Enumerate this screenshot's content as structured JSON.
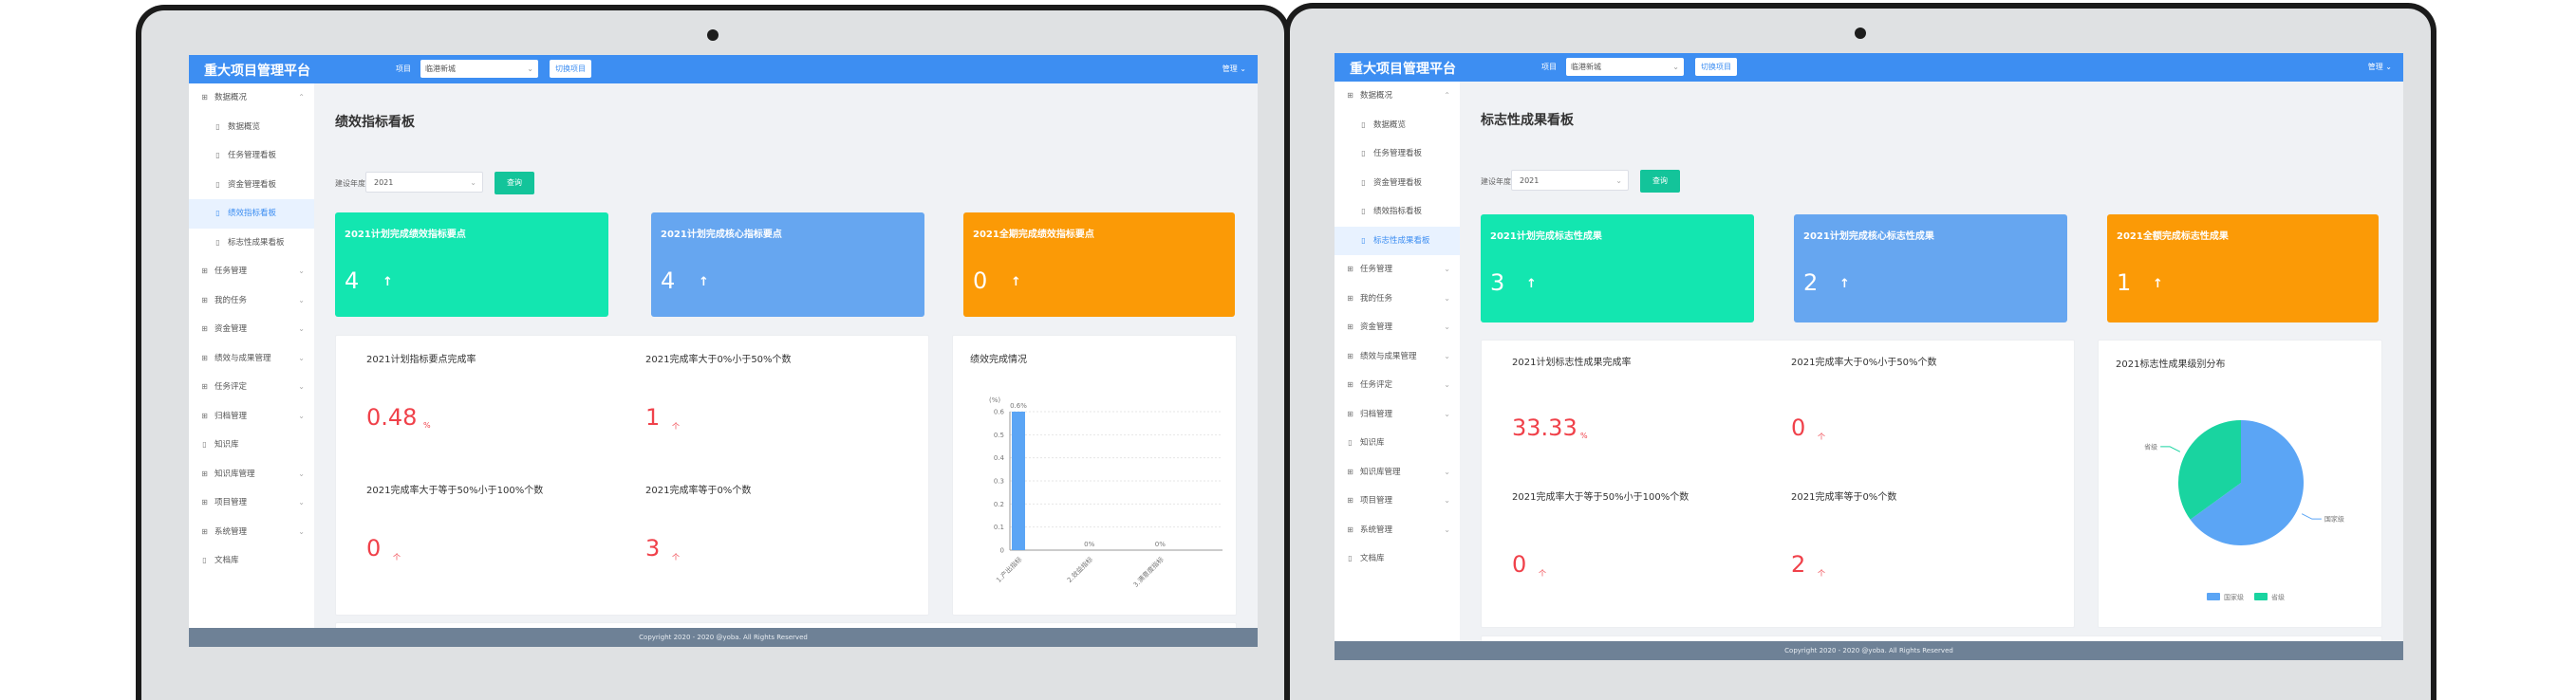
{
  "app": {
    "brand": "重大项目管理平台",
    "region_label": "项目",
    "region_value": "临港新城",
    "switch_label": "切换项目",
    "user": "管理"
  },
  "footer": "Copyright 2020 - 2020 @yoba. All Rights Reserved",
  "colors": {
    "topbar": "#3d8ef2",
    "green": "#13e6b0",
    "blue": "#66a6f0",
    "orange": "#fb9a06",
    "red": "#f0414a",
    "pie_blue": "#5ba5f5",
    "pie_green": "#19d4a0"
  },
  "sidebar": {
    "items": [
      {
        "label": "数据概况",
        "icon": "grid-icon",
        "arrow": "up"
      },
      {
        "label": "数据概览",
        "icon": "doc-icon",
        "sub": true
      },
      {
        "label": "任务管理看板",
        "icon": "doc-icon",
        "sub": true
      },
      {
        "label": "资金管理看板",
        "icon": "doc-icon",
        "sub": true
      },
      {
        "label": "绩效指标看板",
        "icon": "doc-icon",
        "sub": true
      },
      {
        "label": "标志性成果看板",
        "icon": "doc-icon",
        "sub": true
      },
      {
        "label": "任务管理",
        "icon": "grid-icon",
        "arrow": "down"
      },
      {
        "label": "我的任务",
        "icon": "grid-icon",
        "arrow": "down"
      },
      {
        "label": "资金管理",
        "icon": "grid-icon",
        "arrow": "down"
      },
      {
        "label": "绩效与成果管理",
        "icon": "grid-icon",
        "arrow": "down"
      },
      {
        "label": "任务评定",
        "icon": "grid-icon",
        "arrow": "down"
      },
      {
        "label": "归档管理",
        "icon": "grid-icon",
        "arrow": "down"
      },
      {
        "label": "知识库",
        "icon": "doc-icon"
      },
      {
        "label": "知识库管理",
        "icon": "grid-icon",
        "arrow": "down"
      },
      {
        "label": "项目管理",
        "icon": "grid-icon",
        "arrow": "down"
      },
      {
        "label": "系统管理",
        "icon": "grid-icon",
        "arrow": "down"
      },
      {
        "label": "文档库",
        "icon": "doc-icon"
      }
    ]
  },
  "left": {
    "active_index": 4,
    "title": "绩效指标看板",
    "filter_label": "建设年度",
    "filter_value": "2021",
    "query_label": "查询",
    "cards": [
      {
        "title": "2021计划完成绩效指标要点",
        "value": "4"
      },
      {
        "title": "2021计划完成核心指标要点",
        "value": "4"
      },
      {
        "title": "2021全期完成绩效指标要点",
        "value": "0"
      }
    ],
    "kpis": [
      {
        "label": "2021计划指标要点完成率",
        "value": "0.48",
        "unit": "%"
      },
      {
        "label": "2021完成率大于0%小于50%个数",
        "value": "1",
        "unit": "个"
      },
      {
        "label": "2021完成率大于等于50%小于100%个数",
        "value": "0",
        "unit": "个"
      },
      {
        "label": "2021完成率等于0%个数",
        "value": "3",
        "unit": "个"
      }
    ],
    "chart_title": "绩效完成情况"
  },
  "right": {
    "active_index": 5,
    "title": "标志性成果看板",
    "filter_label": "建设年度",
    "filter_value": "2021",
    "query_label": "查询",
    "cards": [
      {
        "title": "2021计划完成标志性成果",
        "value": "3"
      },
      {
        "title": "2021计划完成核心标志性成果",
        "value": "2"
      },
      {
        "title": "2021全额完成标志性成果",
        "value": "1"
      }
    ],
    "kpis": [
      {
        "label": "2021计划标志性成果完成率",
        "value": "33.33",
        "unit": "%"
      },
      {
        "label": "2021完成率大于0%小于50%个数",
        "value": "0",
        "unit": "个"
      },
      {
        "label": "2021完成率大于等于50%小于100%个数",
        "value": "0",
        "unit": "个"
      },
      {
        "label": "2021完成率等于0%个数",
        "value": "2",
        "unit": "个"
      }
    ],
    "chart_title": "2021标志性成果级别分布"
  },
  "chart_data": [
    {
      "type": "bar",
      "ylabel": "(%)",
      "categories": [
        "1.产出指标",
        "2.效益指标",
        "3.满意度指标"
      ],
      "values": [
        0.6,
        0,
        0
      ],
      "data_labels": [
        "0.6%",
        "0%",
        "0%"
      ],
      "ylim": [
        0,
        0.6
      ],
      "yticks": [
        "0",
        "0.1",
        "0.2",
        "0.3",
        "0.4",
        "0.5",
        "0.6"
      ],
      "grid": true
    },
    {
      "type": "pie",
      "categories": [
        "国家级",
        "省级"
      ],
      "values": [
        65,
        35
      ],
      "legend": [
        "国家级",
        "省级"
      ],
      "legend_position": "bottom"
    }
  ]
}
